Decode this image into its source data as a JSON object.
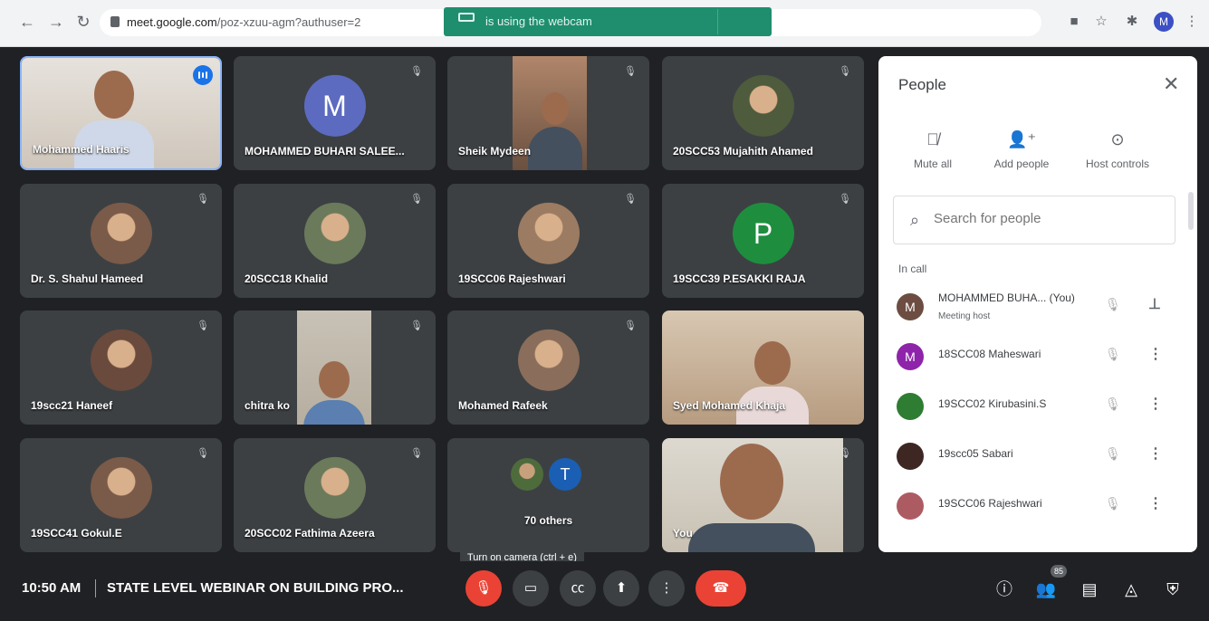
{
  "browser": {
    "url_host": "meet.google.com",
    "url_path": "/poz-xzuu-agm?authuser=2",
    "banner": "is using the webcam",
    "profile_initial": "M"
  },
  "tiles": [
    {
      "name": "Mohammed Haaris",
      "kind": "video"
    },
    {
      "name": "MOHAMMED BUHARI SALEE...",
      "kind": "letter",
      "letter": "M",
      "color": "#5c6bc0"
    },
    {
      "name": "Sheik Mydeen",
      "kind": "video"
    },
    {
      "name": "20SCC53 Mujahith Ahamed",
      "kind": "photo"
    },
    {
      "name": "Dr. S. Shahul Hameed",
      "kind": "photo"
    },
    {
      "name": "20SCC18 Khalid",
      "kind": "photo"
    },
    {
      "name": "19SCC06 Rajeshwari",
      "kind": "photo"
    },
    {
      "name": "19SCC39 P.ESAKKI RAJA",
      "kind": "letter",
      "letter": "P",
      "color": "#1e8e3e"
    },
    {
      "name": "19scc21 Haneef",
      "kind": "photo"
    },
    {
      "name": "chitra ko",
      "kind": "video"
    },
    {
      "name": "Mohamed Rafeek",
      "kind": "photo"
    },
    {
      "name": "Syed Mohamed Khaja",
      "kind": "video"
    },
    {
      "name": "19SCC41 Gokul.E",
      "kind": "photo"
    },
    {
      "name": "20SCC02 Fathima Azeera",
      "kind": "photo"
    },
    {
      "name": "70 others",
      "kind": "others",
      "letter": "T"
    },
    {
      "name": "You",
      "kind": "video"
    }
  ],
  "people_panel": {
    "title": "People",
    "actions": [
      "Mute all",
      "Add people",
      "Host controls"
    ],
    "search_placeholder": "Search for people",
    "section": "In call",
    "participants": [
      {
        "name": "MOHAMMED BUHA...  (You)",
        "sub": "Meeting host",
        "initial": "M",
        "color": "#6d4c41"
      },
      {
        "name": "18SCC08 Maheswari",
        "sub": "",
        "initial": "M",
        "color": "#8e24aa"
      },
      {
        "name": "19SCC02 Kirubasini.S",
        "sub": "",
        "initial": "",
        "color": "#2e7d32"
      },
      {
        "name": "19scc05 Sabari",
        "sub": "",
        "initial": "",
        "color": "#3e2723"
      },
      {
        "name": "19SCC06 Rajeshwari",
        "sub": "",
        "initial": "",
        "color": "#ad5b63"
      }
    ]
  },
  "bottom_bar": {
    "time": "10:50 AM",
    "meeting_title": "STATE LEVEL WEBINAR ON BUILDING PRO...",
    "tooltip": "Turn on camera (ctrl + e)",
    "participant_count": "85"
  }
}
